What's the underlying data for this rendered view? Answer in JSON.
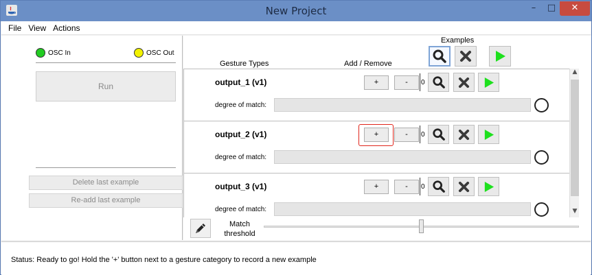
{
  "window": {
    "title": "New Project",
    "controls": {
      "minimize": "–",
      "maximize": "□",
      "close": "✕"
    }
  },
  "menu": [
    "File",
    "View",
    "Actions"
  ],
  "left": {
    "osc_in_label": "OSC In",
    "osc_out_label": "OSC Out",
    "osc_in_color": "#22cc22",
    "osc_out_color": "#f2f200",
    "run_label": "Run",
    "delete_last_label": "Delete last example",
    "readd_last_label": "Re-add last example"
  },
  "header": {
    "gesture_types": "Gesture Types",
    "add_remove": "Add / Remove",
    "examples": "Examples"
  },
  "rows": [
    {
      "name": "output_1 (v1)",
      "plus": "+",
      "minus": "-",
      "count": "0",
      "match_label": "degree of match:",
      "match_value": 0
    },
    {
      "name": "output_2 (v1)",
      "plus": "+",
      "minus": "-",
      "count": "0",
      "match_label": "degree of match:",
      "match_value": 0
    },
    {
      "name": "output_3 (v1)",
      "plus": "+",
      "minus": "-",
      "count": "0",
      "match_label": "degree of match:",
      "match_value": 0
    }
  ],
  "threshold": {
    "label_line1": "Match",
    "label_line2": "threshold",
    "value_fraction": 0.5
  },
  "status": {
    "text": "Status:  Ready to go! Hold the '+' button next to a gesture category to record a new example"
  },
  "icons": {
    "search": "magnifier-icon",
    "delete": "x-icon",
    "play": "play-icon",
    "edit": "pencil-icon"
  },
  "colors": {
    "play_green": "#1ee01e",
    "highlight_red": "#e0241a"
  }
}
